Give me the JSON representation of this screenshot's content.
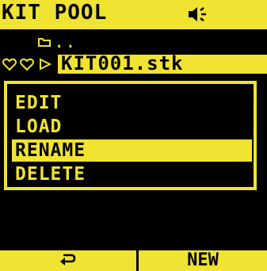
{
  "header": {
    "title": "KIT POOL",
    "speaker_icon": "speaker-icon"
  },
  "browser": {
    "parent_dir_label": "..",
    "folder_icon": "folder-icon",
    "selected_file": "KIT001.stk",
    "status_icons": [
      "heart-outline-icon",
      "heart-outline-icon",
      "play-triangle-icon"
    ]
  },
  "menu": {
    "items": [
      {
        "label": "EDIT",
        "selected": false
      },
      {
        "label": "LOAD",
        "selected": false
      },
      {
        "label": "RENAME",
        "selected": true
      },
      {
        "label": "DELETE",
        "selected": false
      }
    ]
  },
  "softkeys": {
    "left_icon": "return-arrow-icon",
    "right_label": "NEW"
  },
  "colors": {
    "accent": "#f0e332",
    "background": "#000000"
  }
}
